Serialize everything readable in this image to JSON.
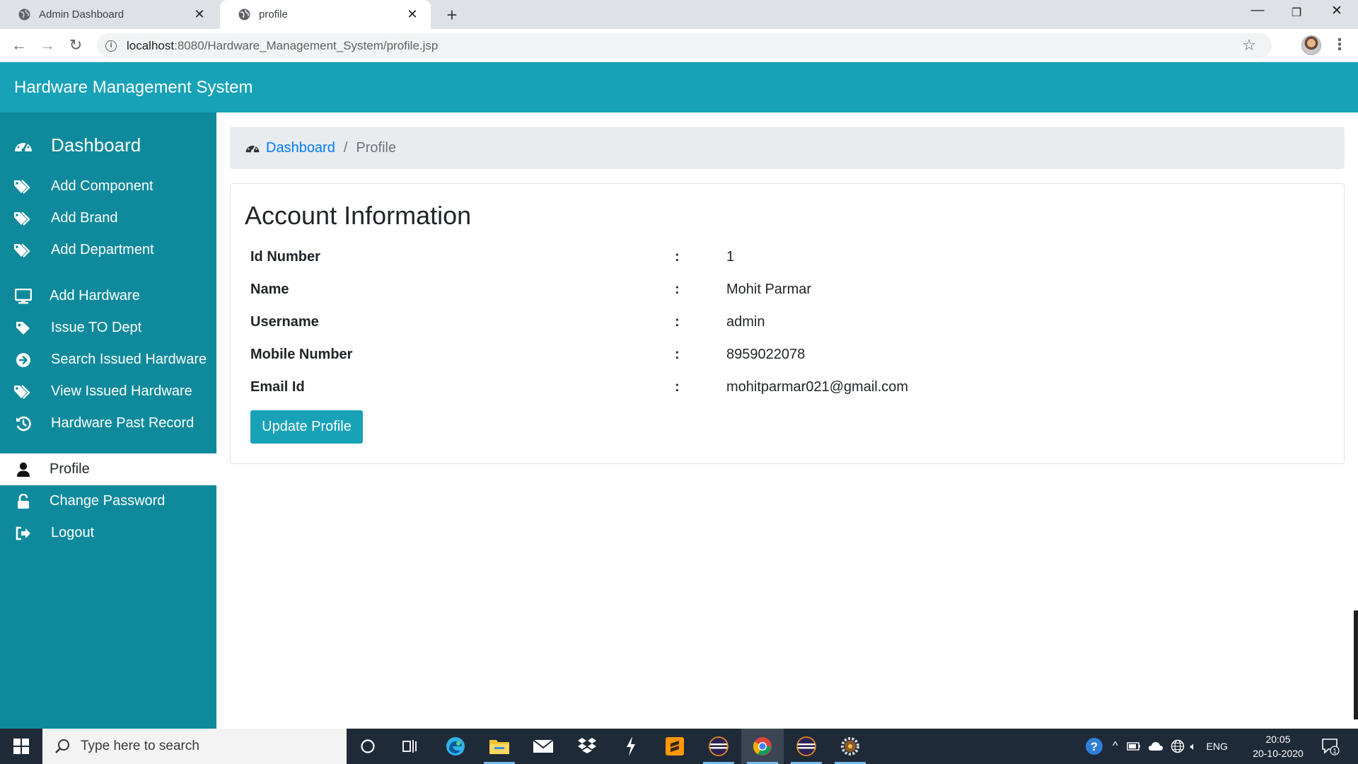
{
  "browser": {
    "tabs": [
      {
        "title": "Admin Dashboard",
        "active": false
      },
      {
        "title": "profile",
        "active": true
      }
    ],
    "url_host": "localhost",
    "url_path": ":8080/Hardware_Management_System/profile.jsp",
    "icons": {
      "back": "back-arrow-icon",
      "forward": "forward-arrow-icon",
      "reload": "reload-icon",
      "info": "info-icon",
      "star": "star-icon",
      "menu": "three-dots-icon"
    }
  },
  "app": {
    "title": "Hardware Management System",
    "accent": "#17a2b8",
    "sidebar_color": "#0f8a9c"
  },
  "sidebar": {
    "items": [
      {
        "label": "Dashboard",
        "icon": "tachometer-icon"
      },
      {
        "label": "Add Component",
        "icon": "tags-icon"
      },
      {
        "label": "Add Brand",
        "icon": "tags-icon"
      },
      {
        "label": "Add Department",
        "icon": "tags-icon"
      },
      {
        "label": "Add Hardware",
        "icon": "desktop-icon"
      },
      {
        "label": "Issue TO Dept",
        "icon": "tag-icon"
      },
      {
        "label": "Search Issued Hardware",
        "icon": "arrow-circle-right-icon"
      },
      {
        "label": "View Issued Hardware",
        "icon": "tags-icon"
      },
      {
        "label": "Hardware Past Record",
        "icon": "history-icon"
      },
      {
        "label": "Profile",
        "icon": "user-icon",
        "active": true
      },
      {
        "label": "Change Password",
        "icon": "unlock-icon"
      },
      {
        "label": "Logout",
        "icon": "sign-out-icon"
      }
    ]
  },
  "breadcrumb": {
    "link": "Dashboard",
    "separator": "/",
    "current": "Profile"
  },
  "account": {
    "title": "Account Information",
    "rows": [
      {
        "label": "Id Number",
        "colon": ":",
        "value": "1"
      },
      {
        "label": "Name",
        "colon": ":",
        "value": "Mohit Parmar"
      },
      {
        "label": "Username",
        "colon": ":",
        "value": "admin"
      },
      {
        "label": "Mobile Number",
        "colon": ":",
        "value": "8959022078"
      },
      {
        "label": "Email Id",
        "colon": ":",
        "value": "mohitparmar021@gmail.com"
      }
    ],
    "button": "Update Profile"
  },
  "taskbar": {
    "search_placeholder": "Type here to search",
    "apps": [
      "cortana-icon",
      "task-view-icon",
      "edge-icon",
      "file-explorer-icon",
      "mail-icon",
      "dropbox-icon",
      "bolt-app-icon",
      "sublime-text-icon",
      "eclipse-icon",
      "chrome-icon",
      "eclipse-icon",
      "settings-app-icon"
    ],
    "language": "ENG",
    "time": "20:05",
    "date": "20-10-2020",
    "notification_count": "1"
  }
}
